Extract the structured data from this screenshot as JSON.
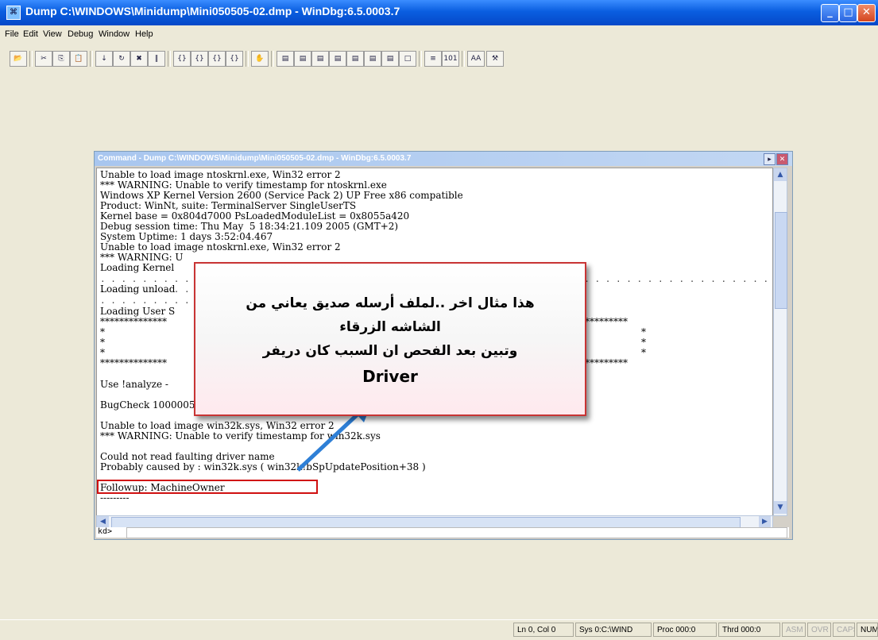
{
  "window": {
    "title": "Dump C:\\WINDOWS\\Minidump\\Mini050505-02.dmp - WinDbg:6.5.0003.7"
  },
  "menu": [
    "File",
    "Edit",
    "View",
    "Debug",
    "Window",
    "Help"
  ],
  "toolbar_icons": [
    "open-icon",
    "cut-icon",
    "copy-icon",
    "paste-icon",
    "go-icon",
    "restart-icon",
    "stop-debugging-icon",
    "break-icon",
    "step-into-icon",
    "step-over-icon",
    "step-out-icon",
    "run-to-cursor-icon",
    "toggle-breakpoint-icon",
    "command-window-icon",
    "watch-window-icon",
    "locals-window-icon",
    "registers-window-icon",
    "memory-window-icon",
    "call-stack-icon",
    "disassembly-icon",
    "scratch-pad-icon",
    "source-mode-icon",
    "hex-mode-icon",
    "font-icon",
    "options-icon"
  ],
  "command_window": {
    "title": "Command - Dump C:\\WINDOWS\\Minidump\\Mini050505-02.dmp - WinDbg:6.5.0003.7",
    "lines": [
      "Unable to load image ntoskrnl.exe, Win32 error 2",
      "*** WARNING: Unable to verify timestamp for ntoskrnl.exe",
      "Windows XP Kernel Version 2600 (Service Pack 2) UP Free x86 compatible",
      "Product: WinNt, suite: TerminalServer SingleUserTS",
      "Kernel base = 0x804d7000 PsLoadedModuleList = 0x8055a420",
      "Debug session time: Thu May  5 18:34:21.109 2005 (GMT+2)",
      "System Uptime: 1 days 3:52:04.467",
      "Unable to load image ntoskrnl.exe, Win32 error 2",
      "*** WARNING: U",
      "Loading Kernel",
      "Loading unload",
      "Loading User S",
      "**************",
      "*",
      "*",
      "*",
      "**************",
      "Use !analyze -",
      "BugCheck 10000050, {e481cddc, 1, bf827db7, 1}",
      "Unable to load image win32k.sys, Win32 error 2",
      "*** WARNING: Unable to verify timestamp for win32k.sys",
      "Could not read faulting driver name",
      "Probably caused by : win32k.sys ( win32k!bSpUpdatePosition+38 )",
      "Followup: MachineOwner",
      "---------"
    ],
    "right_fragments": [
      "*********",
      "*",
      "*",
      "*",
      "*********"
    ],
    "prompt": "kd>",
    "prompt_value": ""
  },
  "callout": {
    "line1": "هذا مثال اخر ..لملف أرسله صديق يعاني من",
    "line2": "الشاشه الزرقاء",
    "line3": "وتبين بعد الفحص ان السبب كان دريفر",
    "line4": "Driver",
    "border_color": "#c83434"
  },
  "status": {
    "position": "Ln 0, Col 0",
    "sys": "Sys 0:C:\\WIND",
    "proc": "Proc 000:0",
    "thrd": "Thrd 000:0",
    "asm": "ASM",
    "ovr": "OVR",
    "caps": "CAPS",
    "num": "NUM"
  }
}
